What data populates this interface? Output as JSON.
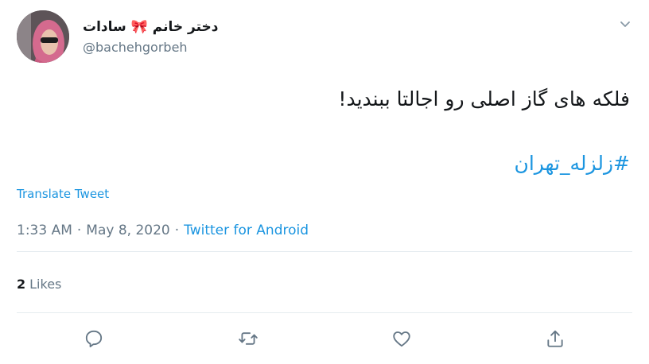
{
  "author": {
    "display_name": "دختر خانم 🎀 سادات",
    "handle": "@bachehgorbeh"
  },
  "tweet": {
    "text": "فلکه های گاز اصلی رو اجالتا ببندید!",
    "hashtag": "#زلزله_تهران",
    "translate_label": "Translate Tweet"
  },
  "meta": {
    "time": "1:33 AM",
    "separator1": "·",
    "date": "May 8, 2020",
    "separator2": "·",
    "source": "Twitter for Android"
  },
  "stats": {
    "likes_count": "2",
    "likes_label": "Likes"
  },
  "icons": {
    "more": "chevron-down-icon",
    "reply": "reply-icon",
    "retweet": "retweet-icon",
    "like": "heart-icon",
    "share": "share-icon"
  },
  "colors": {
    "accent": "#1b95e0",
    "secondary_text": "#657786",
    "icon": "#657786",
    "divider": "#e6ecf0"
  }
}
